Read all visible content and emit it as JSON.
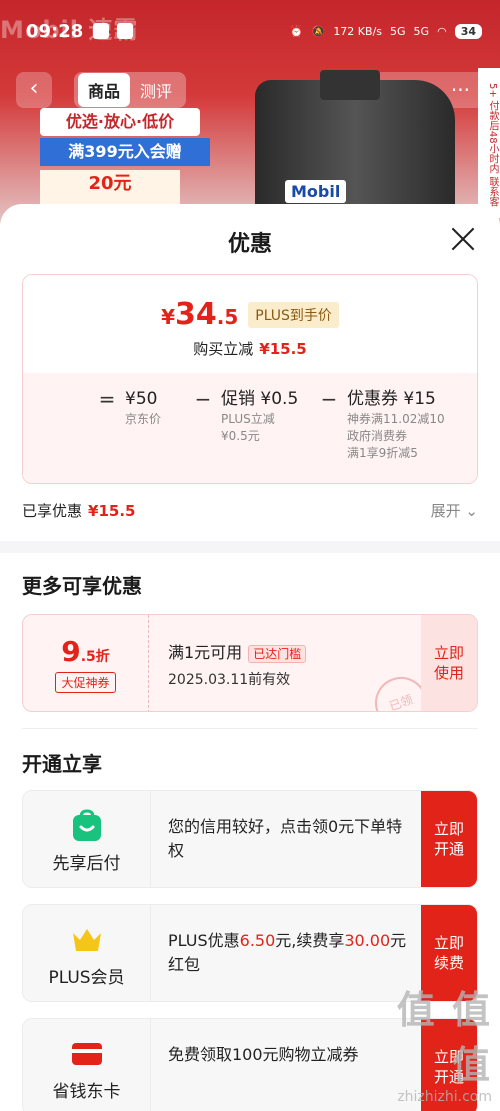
{
  "status_bar": {
    "time": "09:28",
    "network_speed": "172 KB/s",
    "signal_1": "5G",
    "signal_2": "5G",
    "battery": "34"
  },
  "background": {
    "brand": "Mobil",
    "brand_cn": "速霸",
    "tabs": [
      "商品",
      "测评"
    ],
    "banner_1": "优选·放心·低价",
    "banner_2": "满399元入会赠",
    "banner_3": "20元",
    "bottle_label": "Mobil",
    "side_tag": "5+ 付款后48小时内 联系客"
  },
  "sheet": {
    "title": "优惠",
    "price_card": {
      "currency": "¥",
      "price_int": "34",
      "price_dec": ".5",
      "plus_tag": "PLUS到手价",
      "reduce_label": "购买立减",
      "reduce_value": "¥15.5",
      "calc": {
        "eq": "=",
        "base": "¥50",
        "base_sub": "京东价",
        "op1": "−",
        "promo": "促销 ¥0.5",
        "promo_sub1": "PLUS立减",
        "promo_sub2": "¥0.5元",
        "op2": "−",
        "coupon": "优惠券 ¥15",
        "coupon_sub1": "神券满11.02减10",
        "coupon_sub2": "政府消费券",
        "coupon_sub3": "满1享9折减5"
      }
    },
    "enjoyed_label": "已享优惠",
    "enjoyed_value": "¥15.5",
    "expand_label": "展开",
    "more_title": "更多可享优惠",
    "coupon": {
      "discount_big": "9",
      "discount_small": ".5折",
      "tag": "大促神券",
      "condition": "满1元可用",
      "reached": "已达门槛",
      "valid": "2025.03.11前有效",
      "use_label_1": "立即",
      "use_label_2": "使用",
      "stamp": "已领"
    },
    "open_title": "开通立享",
    "services": [
      {
        "name": "先享后付",
        "desc": "您的信用较好，点击领0元下单特权",
        "btn_1": "立即",
        "btn_2": "开通",
        "icon": "shopping-bag-icon",
        "color": "#19c37d"
      },
      {
        "name": "PLUS会员",
        "desc_a": "PLUS优惠",
        "desc_b": "6.50",
        "desc_c": "元,续费享",
        "desc_d": "30.00",
        "desc_e": "元红包",
        "btn_1": "立即",
        "btn_2": "续费",
        "icon": "crown-icon",
        "color": "#f5c518"
      },
      {
        "name": "省钱东卡",
        "desc": "免费领取100元购物立减券",
        "btn_1": "立即",
        "btn_2": "开通",
        "icon": "card-icon",
        "color": "#e2231a"
      }
    ],
    "watermark": {
      "text": "值 值 值",
      "url": "zhizhizhi.com"
    }
  }
}
